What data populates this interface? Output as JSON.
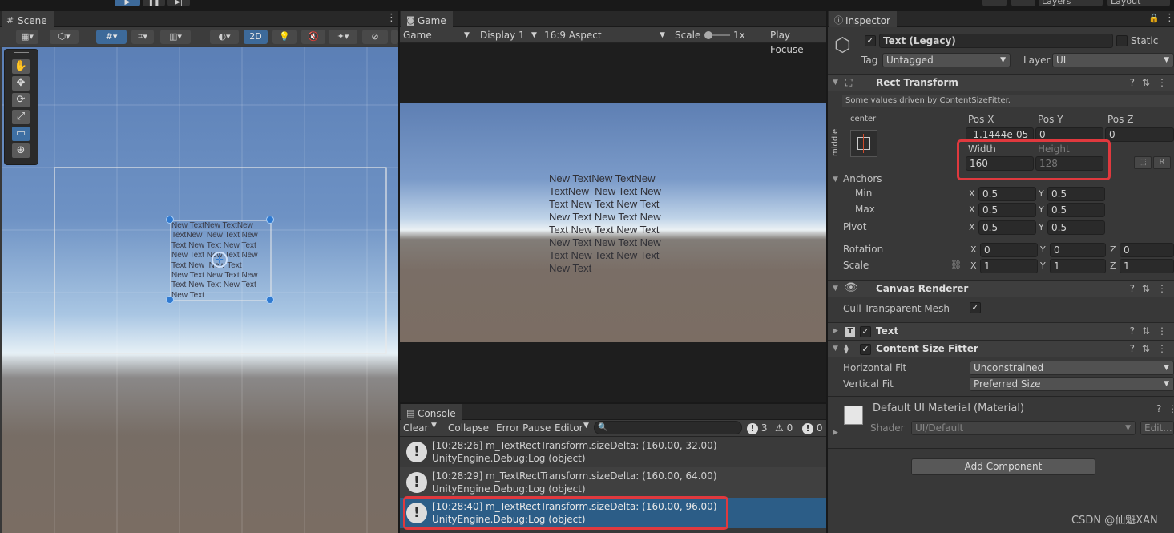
{
  "scene": {
    "tab_label": "Scene",
    "button_2d": "2D",
    "text_lines": [
      "New TextNew TextNew",
      "TextNew  New Text New",
      "Text New Text New Text",
      "New Text New Text New",
      "Text New  New Text",
      "New Text New Text New",
      "Text New Text New Text",
      "New Text"
    ]
  },
  "game": {
    "tab_label": "Game",
    "mode_select": "Game",
    "display_select": "Display 1",
    "aspect_select": "16:9 Aspect",
    "scale_label": "Scale",
    "scale_value": "1x",
    "play_focus": "Play Focuse",
    "text_lines": [
      "New TextNew TextNew",
      "TextNew  New Text New",
      "Text New Text New Text",
      "New Text New Text New",
      "Text New Text New Text",
      "New Text New Text New",
      "Text New Text New Text",
      "New Text"
    ]
  },
  "console": {
    "tab_label": "Console",
    "clear": "Clear",
    "collapse": "Collapse",
    "error_pause": "Error Pause",
    "editor": "Editor",
    "search_placeholder": "",
    "count_log": "3",
    "count_warn": "0",
    "count_error": "0",
    "logs": [
      {
        "line1": "[10:28:26]  m_TextRectTransform.sizeDelta: (160.00, 32.00)",
        "line2": "UnityEngine.Debug:Log (object)"
      },
      {
        "line1": "[10:28:29]  m_TextRectTransform.sizeDelta: (160.00, 64.00)",
        "line2": "UnityEngine.Debug:Log (object)"
      },
      {
        "line1": "[10:28:40]  m_TextRectTransform.sizeDelta: (160.00, 96.00)",
        "line2": "UnityEngine.Debug:Log (object)"
      }
    ]
  },
  "inspector": {
    "tab_label": "Inspector",
    "object_name": "Text (Legacy)",
    "static_label": "Static",
    "tag_label": "Tag",
    "tag_value": "Untagged",
    "layer_label": "Layer",
    "layer_value": "UI",
    "rect_transform": {
      "title": "Rect Transform",
      "note": "Some values driven by ContentSizeFitter.",
      "anchor_h": "center",
      "anchor_v": "middle",
      "pos_x_label": "Pos X",
      "pos_y_label": "Pos Y",
      "pos_z_label": "Pos Z",
      "pos_x": "-1.1444e-05",
      "pos_y": "0",
      "pos_z": "0",
      "width_label": "Width",
      "height_label": "Height",
      "width": "160",
      "height": "128",
      "r_button": "R",
      "anchors_label": "Anchors",
      "min_label": "Min",
      "max_label": "Max",
      "pivot_label": "Pivot",
      "min_x": "0.5",
      "min_y": "0.5",
      "max_x": "0.5",
      "max_y": "0.5",
      "pivot_x": "0.5",
      "pivot_y": "0.5",
      "rotation_label": "Rotation",
      "scale_label": "Scale",
      "rot_x": "0",
      "rot_y": "0",
      "rot_z": "0",
      "scale_x": "1",
      "scale_y": "1",
      "scale_z": "1"
    },
    "canvas_renderer": {
      "title": "Canvas Renderer",
      "cull_label": "Cull Transparent Mesh"
    },
    "text_component": {
      "title": "Text"
    },
    "content_size_fitter": {
      "title": "Content Size Fitter",
      "hfit_label": "Horizontal Fit",
      "hfit_value": "Unconstrained",
      "vfit_label": "Vertical Fit",
      "vfit_value": "Preferred Size"
    },
    "material": {
      "name": "Default UI Material (Material)",
      "shader_label": "Shader",
      "shader_value": "UI/Default",
      "edit": "Edit..."
    },
    "add_component": "Add Component"
  },
  "top": {
    "layers": "Layers",
    "layout": "Layout"
  },
  "watermark": "CSDN @仙魁XAN"
}
